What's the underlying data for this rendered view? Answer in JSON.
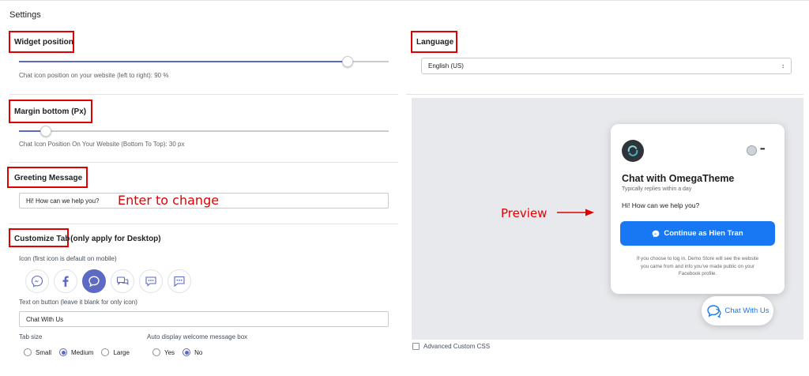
{
  "page": {
    "title": "Settings"
  },
  "widget_position": {
    "label": "Widget position",
    "hint": "Chat icon position on your website (left to right): 90 %",
    "value_percent": 90
  },
  "language": {
    "label": "Language",
    "selected": "English (US)",
    "arrow": "↕"
  },
  "margin_bottom": {
    "label": "Margin bottom (Px)",
    "hint": "Chat Icon Position On Your Website (Bottom To Top): 30 px",
    "value_fraction": 0.07
  },
  "greeting": {
    "label": "Greeting Message",
    "value": "Hi! How can we help you?"
  },
  "customize_tab": {
    "label": "Customize Tab",
    "label_suffix": "(only apply for Desktop)",
    "icon_label": "Icon (first icon is default on mobile)",
    "icons": [
      "messenger-icon",
      "facebook-icon",
      "chat-bubble-icon",
      "chat-double-icon",
      "chat-dots-icon",
      "chat-dots-square-icon"
    ],
    "selected_icon_index": 2,
    "text_on_button_label": "Text on button (leave it blank for only icon)",
    "text_on_button_value": "Chat With Us",
    "tab_size_label": "Tab size",
    "tab_size_options": [
      "Small",
      "Medium",
      "Large"
    ],
    "tab_size_selected": "Medium",
    "auto_display_label": "Auto display welcome message box",
    "auto_display_options": [
      "Yes",
      "No"
    ],
    "auto_display_selected": "No"
  },
  "annotations": {
    "enter_to_change": "Enter to change",
    "preview": "Preview",
    "color": "#e00000"
  },
  "preview": {
    "chat_title": "Chat with OmegaTheme",
    "replies": "Typically replies within a day",
    "greeting": "Hi! How can we help you?",
    "continue_button": "Continue as Hien Tran",
    "privacy_line1": "If you choose to log in, Demo Store will see the website",
    "privacy_line2": "you came from and info you've made public on your",
    "privacy_line3": "Facebook profile.",
    "more": "•••",
    "chat_button_label": "Chat With Us",
    "brand_color": "#1877f2"
  },
  "advanced_css": {
    "label": "Advanced Custom CSS",
    "checked": false
  },
  "colors": {
    "accent": "#5c6ac4",
    "annotation": "#e00000",
    "messenger": "#1877f2"
  }
}
